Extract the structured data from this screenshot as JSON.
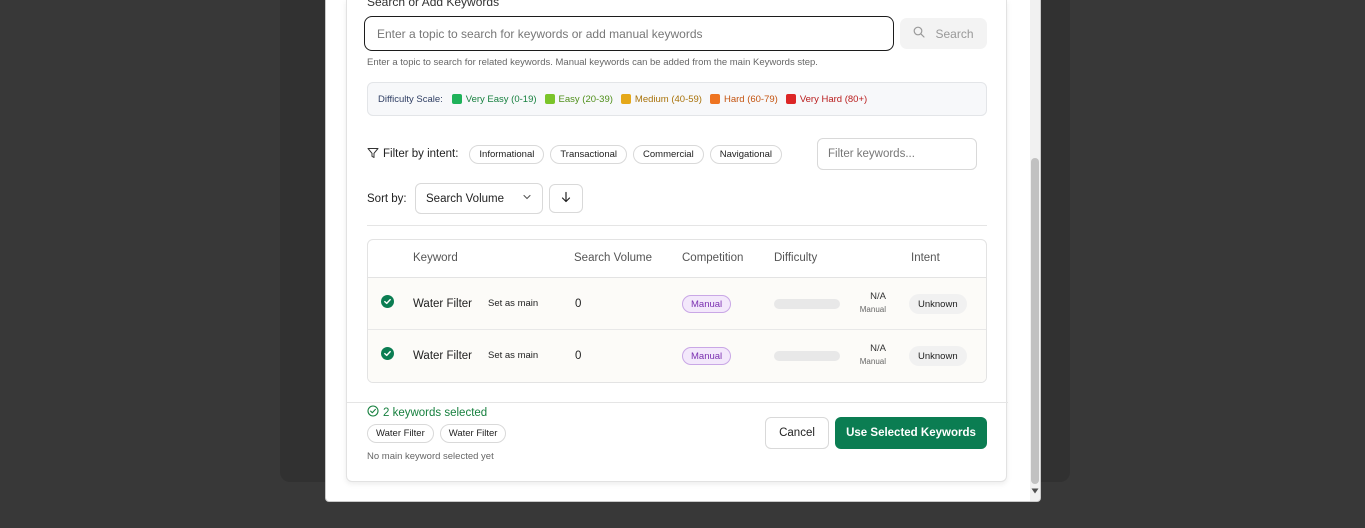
{
  "search": {
    "section_label": "Search or Add Keywords",
    "placeholder": "Enter a topic to search for keywords or add manual keywords",
    "button_label": "Search",
    "help_text": "Enter a topic to search for related keywords. Manual keywords can be added from the main Keywords step."
  },
  "difficulty_scale": {
    "title": "Difficulty Scale:",
    "levels": [
      {
        "label": "Very Easy (0-19)",
        "color": "#1fb25a",
        "text_color": "#17803f"
      },
      {
        "label": "Easy (20-39)",
        "color": "#7bc42a",
        "text_color": "#4f8f1a"
      },
      {
        "label": "Medium (40-59)",
        "color": "#e5a81a",
        "text_color": "#a9730b"
      },
      {
        "label": "Hard (60-79)",
        "color": "#ee7421",
        "text_color": "#c45410"
      },
      {
        "label": "Very Hard (80+)",
        "color": "#dc2626",
        "text_color": "#b91c1c"
      }
    ]
  },
  "filter": {
    "label": "Filter by intent:",
    "intents": [
      "Informational",
      "Transactional",
      "Commercial",
      "Navigational"
    ],
    "keyword_placeholder": "Filter keywords..."
  },
  "sort": {
    "label": "Sort by:",
    "selected": "Search Volume"
  },
  "table": {
    "headers": {
      "keyword": "Keyword",
      "search_volume": "Search Volume",
      "competition": "Competition",
      "difficulty": "Difficulty",
      "intent": "Intent"
    },
    "rows": [
      {
        "keyword": "Water Filter",
        "action": "Set as main",
        "volume": "0",
        "competition": "Manual",
        "difficulty_level": 0,
        "difficulty": "N/A",
        "difficulty_note": "Manual",
        "intent": "Unknown"
      },
      {
        "keyword": "Water Filter",
        "action": "Set as main",
        "volume": "0",
        "competition": "Manual",
        "difficulty_level": 0,
        "difficulty": "N/A",
        "difficulty_note": "Manual",
        "intent": "Unknown"
      }
    ]
  },
  "footer": {
    "selected_count": "2 keywords selected",
    "selected_tags": [
      "Water Filter",
      "Water Filter"
    ],
    "no_main_text": "No main keyword selected yet",
    "cancel_label": "Cancel",
    "use_label": "Use Selected Keywords"
  },
  "colors": {
    "primary": "#0b7d52",
    "manual_badge": "#7a2fb0"
  }
}
